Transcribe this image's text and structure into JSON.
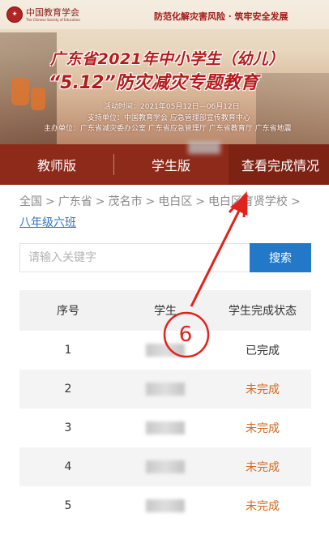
{
  "banner": {
    "logo_cn": "中国教育学会",
    "logo_en": "The Chinese Society of Education",
    "slogan": "防范化解灾害风险 · 筑牢安全发展",
    "title_line1": "广东省2021年中小学生（幼儿）",
    "title_line2": "“5.12”防灾减灾专题教育",
    "time": "活动时间：2021年05月12日—06月12日",
    "support": "支持单位：中国教育学会 应急管理部宣传教育中心",
    "host": "主办单位：广东省减灾委办公室 广东省应急管理厅 广东省教育厅 广东省地震"
  },
  "nav": {
    "tabs": [
      {
        "label": "教师版"
      },
      {
        "label": "学生版"
      },
      {
        "label": "查看完成情况"
      }
    ]
  },
  "breadcrumb": {
    "items": [
      "全国",
      "广东省",
      "茂名市",
      "电白区",
      "电白区育贤学校"
    ],
    "separator": ">",
    "current": "八年级六班"
  },
  "search": {
    "placeholder": "请输入关键字",
    "button_label": "搜索"
  },
  "table": {
    "headers": [
      "序号",
      "学生",
      "学生完成状态"
    ],
    "rows": [
      {
        "no": "1",
        "status": "已完成",
        "status_color": "#333333"
      },
      {
        "no": "2",
        "status": "未完成",
        "status_color": "#d2691e"
      },
      {
        "no": "3",
        "status": "未完成",
        "status_color": "#d2691e"
      },
      {
        "no": "4",
        "status": "未完成",
        "status_color": "#d2691e"
      },
      {
        "no": "5",
        "status": "未完成",
        "status_color": "#d2691e"
      }
    ]
  },
  "annotation": {
    "step_number": "6",
    "color": "#e0231c"
  },
  "colors": {
    "nav_bg": "#8e2a19",
    "accent_blue": "#2478c8",
    "pending": "#d2691e"
  }
}
